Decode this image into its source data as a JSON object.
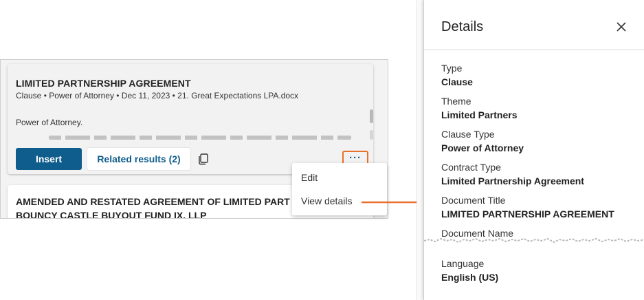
{
  "results": {
    "card1": {
      "title": "LIMITED PARTNERSHIP AGREEMENT",
      "meta": "Clause • Power of Attorney • Dec 11, 2023 • 21. Great Expectations LPA.docx",
      "snippet": "Power of Attorney.",
      "insert_label": "Insert",
      "related_label": "Related results (2)",
      "more_label": "···"
    },
    "card2": {
      "title_line1": "AMENDED AND RESTATED AGREEMENT OF LIMITED PART",
      "title_line2": "BOUNCY CASTLE BUYOUT FUND IX, LLP"
    }
  },
  "menu": {
    "items": [
      "Edit",
      "View details"
    ]
  },
  "details": {
    "title": "Details",
    "fields": [
      {
        "label": "Type",
        "value": "Clause"
      },
      {
        "label": "Theme",
        "value": "Limited Partners"
      },
      {
        "label": "Clause Type",
        "value": "Power of Attorney"
      },
      {
        "label": "Contract Type",
        "value": "Limited Partnership Agreement"
      },
      {
        "label": "Document Title",
        "value": "LIMITED PARTNERSHIP AGREEMENT"
      },
      {
        "label": "Document Name",
        "value": ""
      },
      {
        "label": "Language",
        "value": "English (US)"
      }
    ]
  },
  "colors": {
    "accent": "#0f5d8c",
    "highlight": "#e8702a"
  }
}
